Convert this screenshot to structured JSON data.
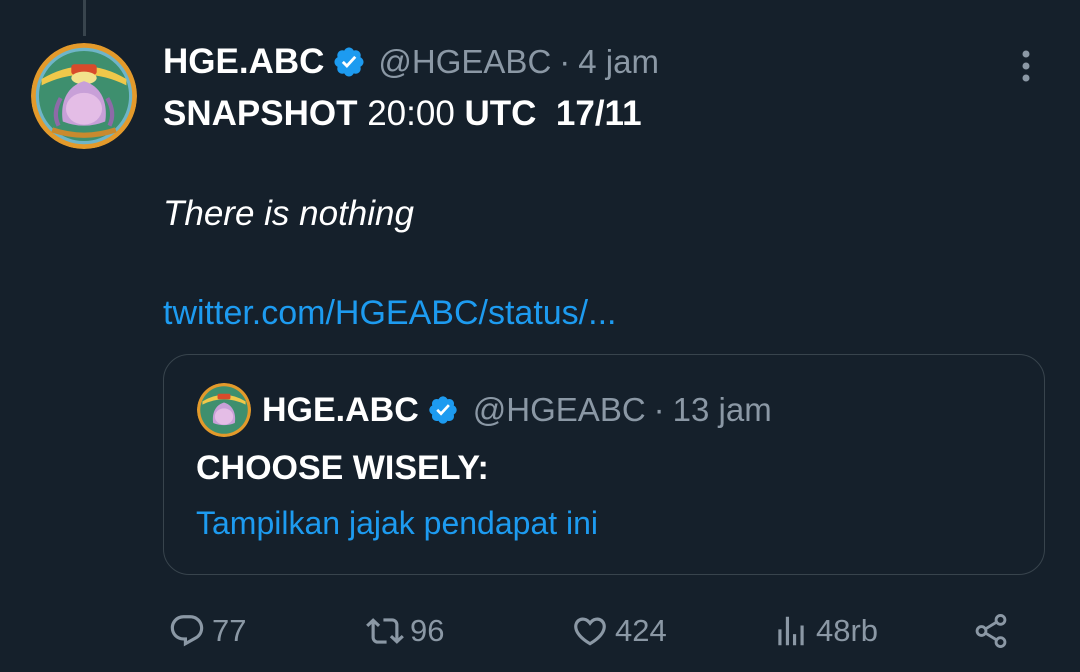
{
  "tweet": {
    "author": {
      "name": "HGE.ABC",
      "handle": "@HGEABC",
      "verified_icon": "verified-badge-icon",
      "avatar": "avatar"
    },
    "separator": "·",
    "time": "4 jam",
    "more_icon": "more-options-icon",
    "text": {
      "snapshot_a": "SNAPSHOT",
      "snapshot_b": " 20:00 ",
      "snapshot_c": "UTC  17/11",
      "line2": "There is nothing",
      "link": "twitter.com/HGEABC/status/..."
    },
    "quote": {
      "name": "HGE.ABC",
      "handle": "@HGEABC",
      "separator": "·",
      "time": "13 jam",
      "text": "CHOOSE WISELY:",
      "poll_link": "Tampilkan jajak pendapat ini"
    },
    "actions": {
      "replies": "77",
      "retweets": "96",
      "likes": "424",
      "views": "48rb",
      "icons": [
        "reply-icon",
        "retweet-icon",
        "like-icon",
        "views-icon",
        "share-icon"
      ]
    }
  },
  "colors": {
    "background": "#15202b",
    "text": "#ffffff",
    "muted": "#8b98a5",
    "link": "#1d9bf0",
    "verified": "#1d9bf0",
    "border": "#38444d"
  }
}
